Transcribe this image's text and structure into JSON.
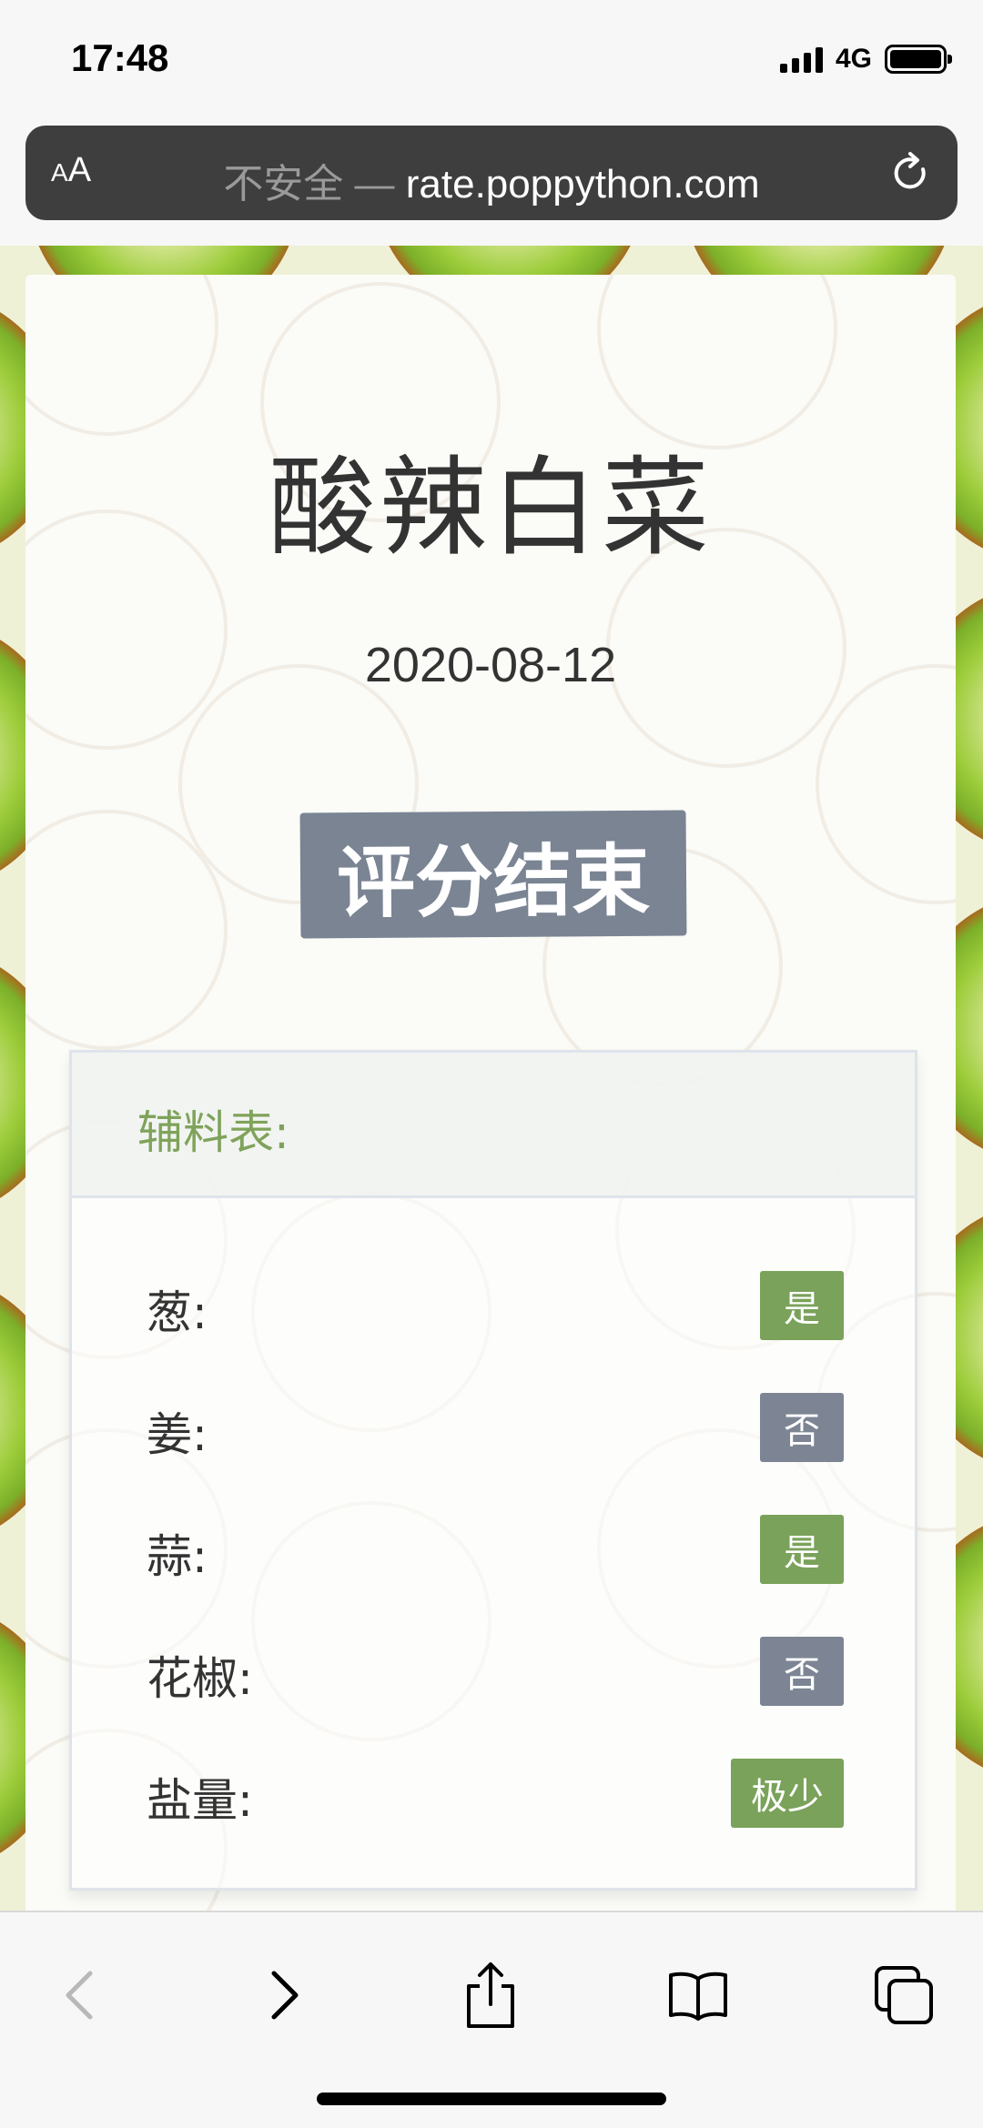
{
  "status_bar": {
    "time": "17:48",
    "network": "4G",
    "signal_bars": 4,
    "battery_level": 1.0
  },
  "address_bar": {
    "text_size_small": "A",
    "text_size_big": "A",
    "security_label": "不安全",
    "separator": " — ",
    "domain": "rate.poppython.com",
    "reload_icon": "reload-icon"
  },
  "page": {
    "title": "酸辣白菜",
    "date": "2020-08-12",
    "status": "评分结束",
    "table_header": "辅料表:",
    "rows": [
      {
        "label": "葱:",
        "value": "是",
        "kind": "yes"
      },
      {
        "label": "姜:",
        "value": "否",
        "kind": "no"
      },
      {
        "label": "蒜:",
        "value": "是",
        "kind": "yes"
      },
      {
        "label": "花椒:",
        "value": "否",
        "kind": "no"
      },
      {
        "label": "盐量:",
        "value": "极少",
        "kind": "yes"
      }
    ]
  },
  "toolbar": {
    "back_icon": "chevron-left-icon",
    "forward_icon": "chevron-right-icon",
    "share_icon": "share-icon",
    "bookmarks_icon": "book-icon",
    "tabs_icon": "tabs-icon"
  },
  "colors": {
    "accent_green": "#7aa25a",
    "badge_gray": "#7d8594",
    "address_bar_bg": "#3e3e3e"
  }
}
